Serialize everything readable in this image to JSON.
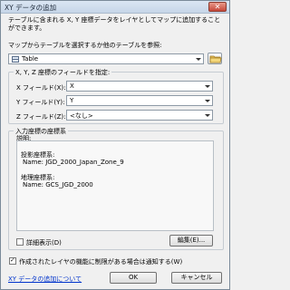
{
  "window": {
    "title": "XY データの追加",
    "close_glyph": "✕"
  },
  "description": "テーブルに含まれる X, Y 座標データをレイヤとしてマップに追加することができます。",
  "table_select": {
    "label": "マップからテーブルを選択するか他のテーブルを参照:",
    "value": "Table"
  },
  "fields": {
    "group_title": "X, Y, Z 座標のフィールドを指定:",
    "x": {
      "label": "X フィールド(X):",
      "value": "X"
    },
    "y": {
      "label": "Y フィールド(Y):",
      "value": "Y"
    },
    "z": {
      "label": "Z フィールド(Z):",
      "value": "<なし>"
    }
  },
  "coordinate_system": {
    "group_title": "入力座標の座標系",
    "description_label": "説明:",
    "projected_label": "投影座標系:",
    "projected_name": "Name: JGD_2000_Japan_Zone_9",
    "geographic_label": "地理座標系:",
    "geographic_name": "Name: GCS_JGD_2000",
    "details_label": "詳細表示(D)",
    "edit_button": "編集(E)..."
  },
  "warn_checkbox": {
    "label": "作成されたレイヤの機能に制限がある場合は通知する(W)",
    "checked": true
  },
  "help_link": "XY データの追加について",
  "ok_button": "OK",
  "cancel_button": "キャンセル"
}
